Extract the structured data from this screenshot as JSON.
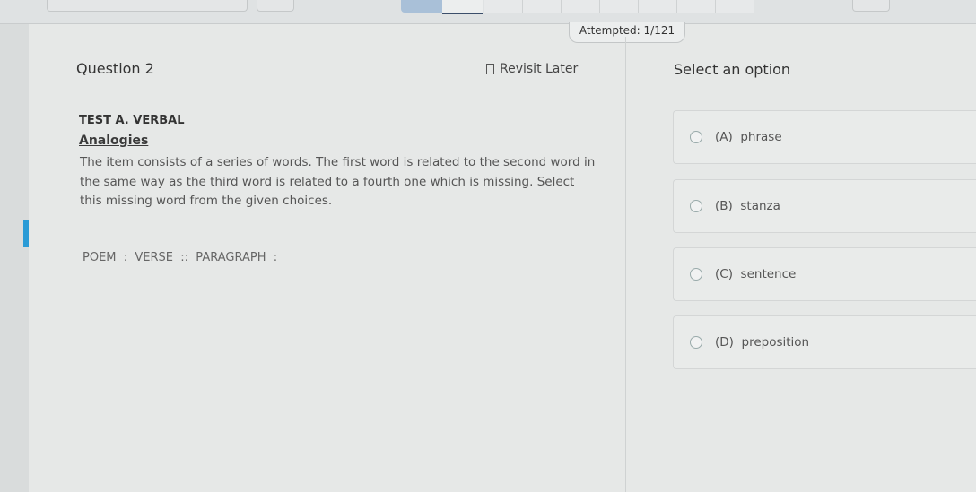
{
  "header": {
    "attempted": "Attempted: 1/121"
  },
  "question": {
    "title": "Question 2",
    "revisit_label": "Revisit Later",
    "section": "TEST A. VERBAL",
    "subsection": "Analogies",
    "instructions": "The item consists of a series of words. The first word is related to the second word in the same way as the third word is related to a fourth one which is missing. Select this missing word from the given choices.",
    "prompt": "POEM  :  VERSE  ::  PARAGRAPH  :"
  },
  "answers": {
    "heading": "Select an option",
    "options": [
      {
        "label": "(A)  phrase"
      },
      {
        "label": "(B)  stanza"
      },
      {
        "label": "(C)  sentence"
      },
      {
        "label": "(D)  preposition"
      }
    ]
  },
  "colors": {
    "accent": "#2a9bd6"
  }
}
